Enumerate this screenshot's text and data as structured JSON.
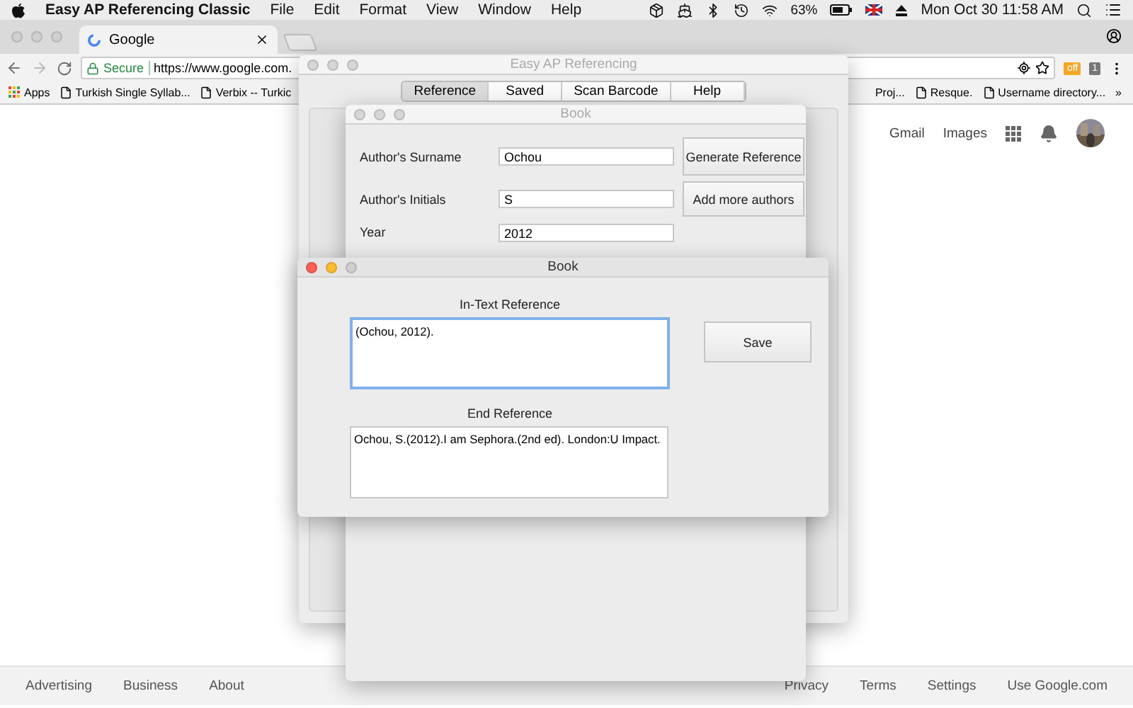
{
  "menu_bar": {
    "app_name": "Easy AP Referencing Classic",
    "menus": [
      "File",
      "Edit",
      "Format",
      "View",
      "Window",
      "Help"
    ],
    "battery": "63%",
    "clock": "Mon Oct 30  11:58 AM"
  },
  "browser": {
    "tab_title": "Google",
    "secure_label": "Secure",
    "url": "https://www.google.com.",
    "extension_badge": "off",
    "extension_count": "1",
    "bookmarks": [
      {
        "kind": "apps",
        "label": "Apps"
      },
      {
        "kind": "page",
        "label": "Turkish Single Syllab..."
      },
      {
        "kind": "page",
        "label": "Verbix -- Turkic"
      }
    ],
    "bookmarks_right": [
      {
        "kind": "plain",
        "label": "Proj..."
      },
      {
        "kind": "page",
        "label": "Resque."
      },
      {
        "kind": "page",
        "label": "Username directory..."
      }
    ],
    "overflow": "»"
  },
  "google": {
    "header_links": [
      "Gmail",
      "Images"
    ],
    "footer_left": [
      "Advertising",
      "Business",
      "About"
    ],
    "footer_right": [
      "Privacy",
      "Terms",
      "Settings",
      "Use Google.com"
    ]
  },
  "main_window": {
    "title": "Easy AP Referencing",
    "active": false,
    "tabs": [
      {
        "label": "Reference",
        "selected": true
      },
      {
        "label": "Saved",
        "selected": false
      },
      {
        "label": "Scan Barcode",
        "selected": false
      },
      {
        "label": "Help",
        "selected": false
      }
    ]
  },
  "book_form": {
    "title": "Book",
    "active": false,
    "fields": [
      {
        "label": "Author's Surname",
        "value": "Ochou"
      },
      {
        "label": "Author's Initials",
        "value": "S"
      },
      {
        "label": "Year",
        "value": "2012"
      }
    ],
    "buttons": [
      "Generate Reference",
      "Add more authors"
    ]
  },
  "book_result": {
    "title": "Book",
    "active": true,
    "in_text_label": "In-Text Reference",
    "in_text_value": "(Ochou, 2012).",
    "in_text_focused": true,
    "end_label": "End Reference",
    "end_value": "Ochou, S.(2012).I am Sephora.(2nd ed). London:U Impact.",
    "end_focused": false,
    "save": "Save"
  }
}
